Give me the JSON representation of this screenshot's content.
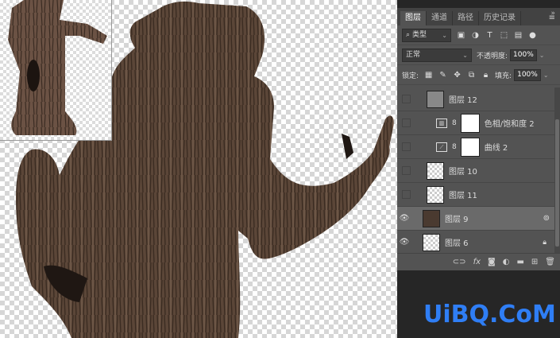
{
  "panel": {
    "tabs": [
      {
        "label": "图层",
        "active": true
      },
      {
        "label": "通道",
        "active": false
      },
      {
        "label": "路径",
        "active": false
      },
      {
        "label": "历史记录",
        "active": false
      }
    ],
    "filter_label": "类型",
    "blend_mode": "正常",
    "opacity_label": "不透明度:",
    "opacity_value": "100%",
    "lock_label": "锁定:",
    "fill_label": "填充:",
    "fill_value": "100%"
  },
  "layers": [
    {
      "name": "图层 12",
      "visible": false,
      "type": "pixel"
    },
    {
      "name": "色相/饱和度 2",
      "visible": false,
      "type": "adjustment",
      "adj_icon": "hue-saturation-icon"
    },
    {
      "name": "曲线 2",
      "visible": false,
      "type": "adjustment",
      "adj_icon": "curves-icon"
    },
    {
      "name": "图层 10",
      "visible": false,
      "type": "pixel"
    },
    {
      "name": "图层 11",
      "visible": false,
      "type": "pixel"
    },
    {
      "name": "图层 9",
      "visible": true,
      "type": "pixel",
      "selected": true
    },
    {
      "name": "图层 6",
      "visible": true,
      "type": "pixel",
      "locked": true
    }
  ],
  "watermark": "UiBQ.CoM",
  "colors": {
    "panel_bg": "#535353",
    "panel_tabbar": "#424242",
    "selected_row": "#6a6a6a",
    "watermark": "#2f7ef5",
    "bark": "#5b4638"
  }
}
